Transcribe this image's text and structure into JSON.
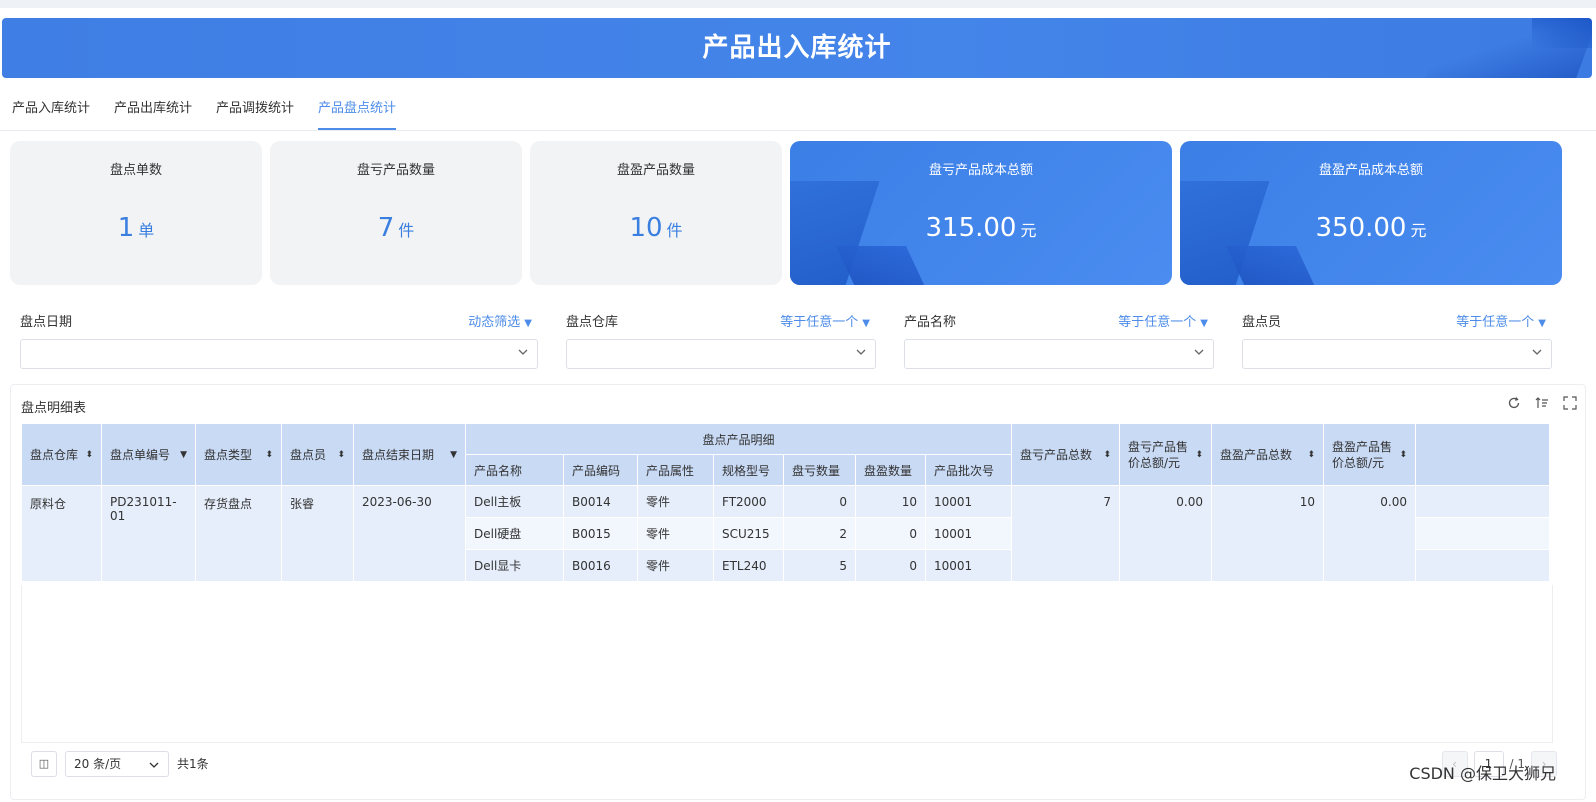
{
  "header": {
    "title": "产品出入库统计"
  },
  "tabs": [
    {
      "label": "产品入库统计"
    },
    {
      "label": "产品出库统计"
    },
    {
      "label": "产品调拨统计"
    },
    {
      "label": "产品盘点统计"
    }
  ],
  "cards": [
    {
      "title": "盘点单数",
      "value": "1",
      "unit": "单"
    },
    {
      "title": "盘亏产品数量",
      "value": "7",
      "unit": "件"
    },
    {
      "title": "盘盈产品数量",
      "value": "10",
      "unit": "件"
    },
    {
      "title": "盘亏产品成本总额",
      "value": "315.00",
      "unit": "元"
    },
    {
      "title": "盘盈产品成本总额",
      "value": "350.00",
      "unit": "元"
    }
  ],
  "filters": [
    {
      "label": "盘点日期",
      "mode": "动态筛选",
      "value": ""
    },
    {
      "label": "盘点仓库",
      "mode": "等于任意一个",
      "value": ""
    },
    {
      "label": "产品名称",
      "mode": "等于任意一个",
      "value": ""
    },
    {
      "label": "盘点员",
      "mode": "等于任意一个",
      "value": ""
    }
  ],
  "table": {
    "title": "盘点明细表",
    "group_header": "盘点产品明细",
    "columns": {
      "warehouse": "盘点仓库",
      "order_no": "盘点单编号",
      "type": "盘点类型",
      "operator": "盘点员",
      "end_date": "盘点结束日期",
      "product_name": "产品名称",
      "product_code": "产品编码",
      "product_attr": "产品属性",
      "spec": "规格型号",
      "loss_qty": "盘亏数量",
      "gain_qty": "盘盈数量",
      "batch": "产品批次号",
      "loss_total": "盘亏产品总数",
      "loss_amount_1": "盘亏产品售",
      "loss_amount_2": "价总额/元",
      "gain_total": "盘盈产品总数",
      "gain_amount_1": "盘盈产品售",
      "gain_amount_2": "价总额/元"
    },
    "group": {
      "warehouse": "原料仓",
      "order_no": "PD231011-01",
      "type": "存货盘点",
      "operator": "张睿",
      "end_date": "2023-06-30",
      "loss_total": "7",
      "loss_amount": "0.00",
      "gain_total": "10",
      "gain_amount": "0.00"
    },
    "rows": [
      {
        "product_name": "Dell主板",
        "product_code": "B0014",
        "product_attr": "零件",
        "spec": "FT2000",
        "loss_qty": "0",
        "gain_qty": "10",
        "batch": "10001"
      },
      {
        "product_name": "Dell硬盘",
        "product_code": "B0015",
        "product_attr": "零件",
        "spec": "SCU215",
        "loss_qty": "2",
        "gain_qty": "0",
        "batch": "10001"
      },
      {
        "product_name": "Dell显卡",
        "product_code": "B0016",
        "product_attr": "零件",
        "spec": "ETL240",
        "loss_qty": "5",
        "gain_qty": "0",
        "batch": "10001"
      }
    ]
  },
  "pager": {
    "page_size": "20 条/页",
    "total": "共1条",
    "current": "1",
    "of": "/ 1"
  },
  "watermark": "CSDN @保卫大狮兄",
  "colors": {
    "accent": "#4d8ce8",
    "header_bg": "#3f7ee4",
    "table_header": "#c9daf5",
    "table_row": "#e6eefb"
  }
}
